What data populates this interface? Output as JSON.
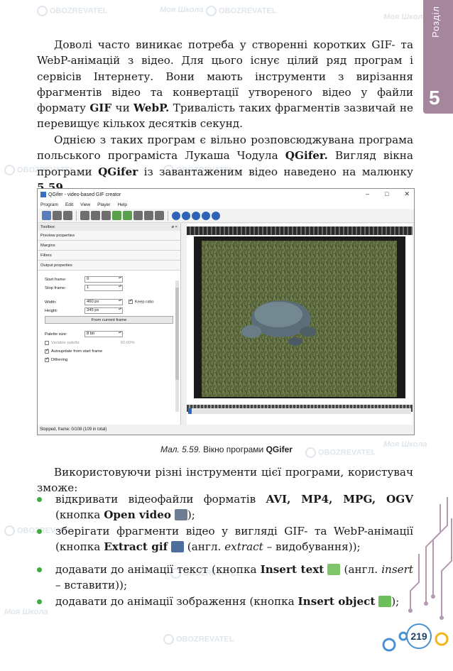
{
  "chapter": {
    "label": "Розділ",
    "number": "5"
  },
  "watermarks": {
    "brand_a": "OBOZREVATEL",
    "brand_b": "Моя Школа"
  },
  "paragraphs": {
    "p1": {
      "t1": "Доволі часто виникає потреба у створенні коротких GIF- та WebP-анімацій з відео. Для цього існує цілий ряд програм і сервісів Інтернету. Вони мають інструменти з вирізання фрагментів відео та конвертації утвореного відео у файли формату ",
      "b1": "GIF",
      "t2": " чи ",
      "b2": "WebP.",
      "t3": " Тривалість таких фрагментів зазвичай не перевищує кількох десятків секунд."
    },
    "p2": {
      "t1": "Однією з таких програм є вільно розповсюджувана програма польського програміста Лукаша Чодула ",
      "b1": "QGifer.",
      "t2": " Вигляд вікна програми ",
      "b2": "QGifer",
      "t3": " із завантаженим відео наведено на малюнку ",
      "b3": "5.59."
    },
    "p3": "Використовуючи різні інструменти цієї програми, користувач зможе:"
  },
  "window": {
    "title": "QGifer - video-based GIF creator",
    "controls": [
      "–",
      "□",
      "✕"
    ],
    "menu": [
      "Program",
      "Edit",
      "View",
      "Player",
      "Help"
    ],
    "panel_title": "Toolbox",
    "panel_close": "ø ×",
    "sections": [
      "Preview properties",
      "Margins",
      "Filters",
      "Output properties"
    ],
    "fields": {
      "start_label": "Start frame:",
      "start_value": "0",
      "stop_label": "Stop frame:",
      "stop_value": "1",
      "width_label": "Width:",
      "width_value": "460 px",
      "height_label": "Height:",
      "height_value": "345 px",
      "keep_ratio": "Keep ratio",
      "from_frame_button": "From current frame",
      "palette_label": "Palette size:",
      "palette_value": "8 bit",
      "variable_palette": "Variable palette",
      "variable_value": "60,00%",
      "autoupdate": "Autoupdate from start frame",
      "dithering": "Dithering"
    },
    "status": "Stopped, frame: 0/108 (109 in total)",
    "playback": {
      "position_percent": 0
    }
  },
  "caption": {
    "label": "Мал. 5.59.",
    "text": " Вікно програми ",
    "bold": "QGifer"
  },
  "bullets": [
    {
      "t1": "відкривати відеофайли форматів ",
      "b1": "AVI, MP4, MPG, OGV",
      "t2": " (кнопка ",
      "b2": "Open video",
      "t3": ");"
    },
    {
      "t1": "зберігати фрагменти відео у вигляді GIF- та WebP-анімації (кнопка ",
      "b1": "Extract gif",
      "t2": " (англ. ",
      "i1": "extract",
      "t3": " – видобування));"
    },
    {
      "t1": "додавати до анімації текст (кнопка ",
      "b1": "Insert text",
      "t2": " (англ. ",
      "i1": "insert",
      "t3": " – вставити));"
    },
    {
      "t1": "додавати до анімації зображення (кнопка ",
      "b1": "Insert object",
      "t2": ");"
    }
  ],
  "page_number": "219",
  "colors": {
    "accent_tab": "#a4869d",
    "bullet": "#3faa3f",
    "page_ring": "#4a90d0"
  }
}
